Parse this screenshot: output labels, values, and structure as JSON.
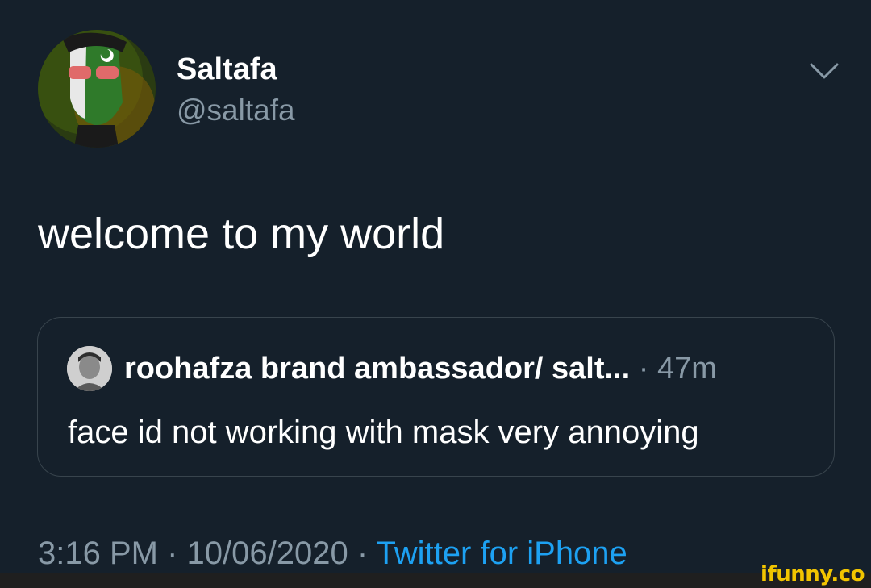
{
  "author": {
    "display_name": "Saltafa",
    "handle": "@saltafa",
    "avatar_icon": "profile-avatar-green-face-paint"
  },
  "tweet": {
    "text": "welcome to my world"
  },
  "quoted_tweet": {
    "author_name": "roohafza brand ambassador/ salt...",
    "separator": "·",
    "time": "47m",
    "text": "face id not working with mask very annoying",
    "avatar_icon": "quoted-profile-avatar"
  },
  "meta": {
    "time": "3:16 PM",
    "separator_1": " · ",
    "date": "10/06/2020",
    "separator_2": " · ",
    "source": "Twitter for iPhone"
  },
  "watermark": "ifunny.co",
  "colors": {
    "background": "#15202b",
    "text_primary": "#ffffff",
    "text_secondary": "#8899a6",
    "link": "#1da1f2",
    "border": "#38444d",
    "watermark": "#f2c500"
  }
}
